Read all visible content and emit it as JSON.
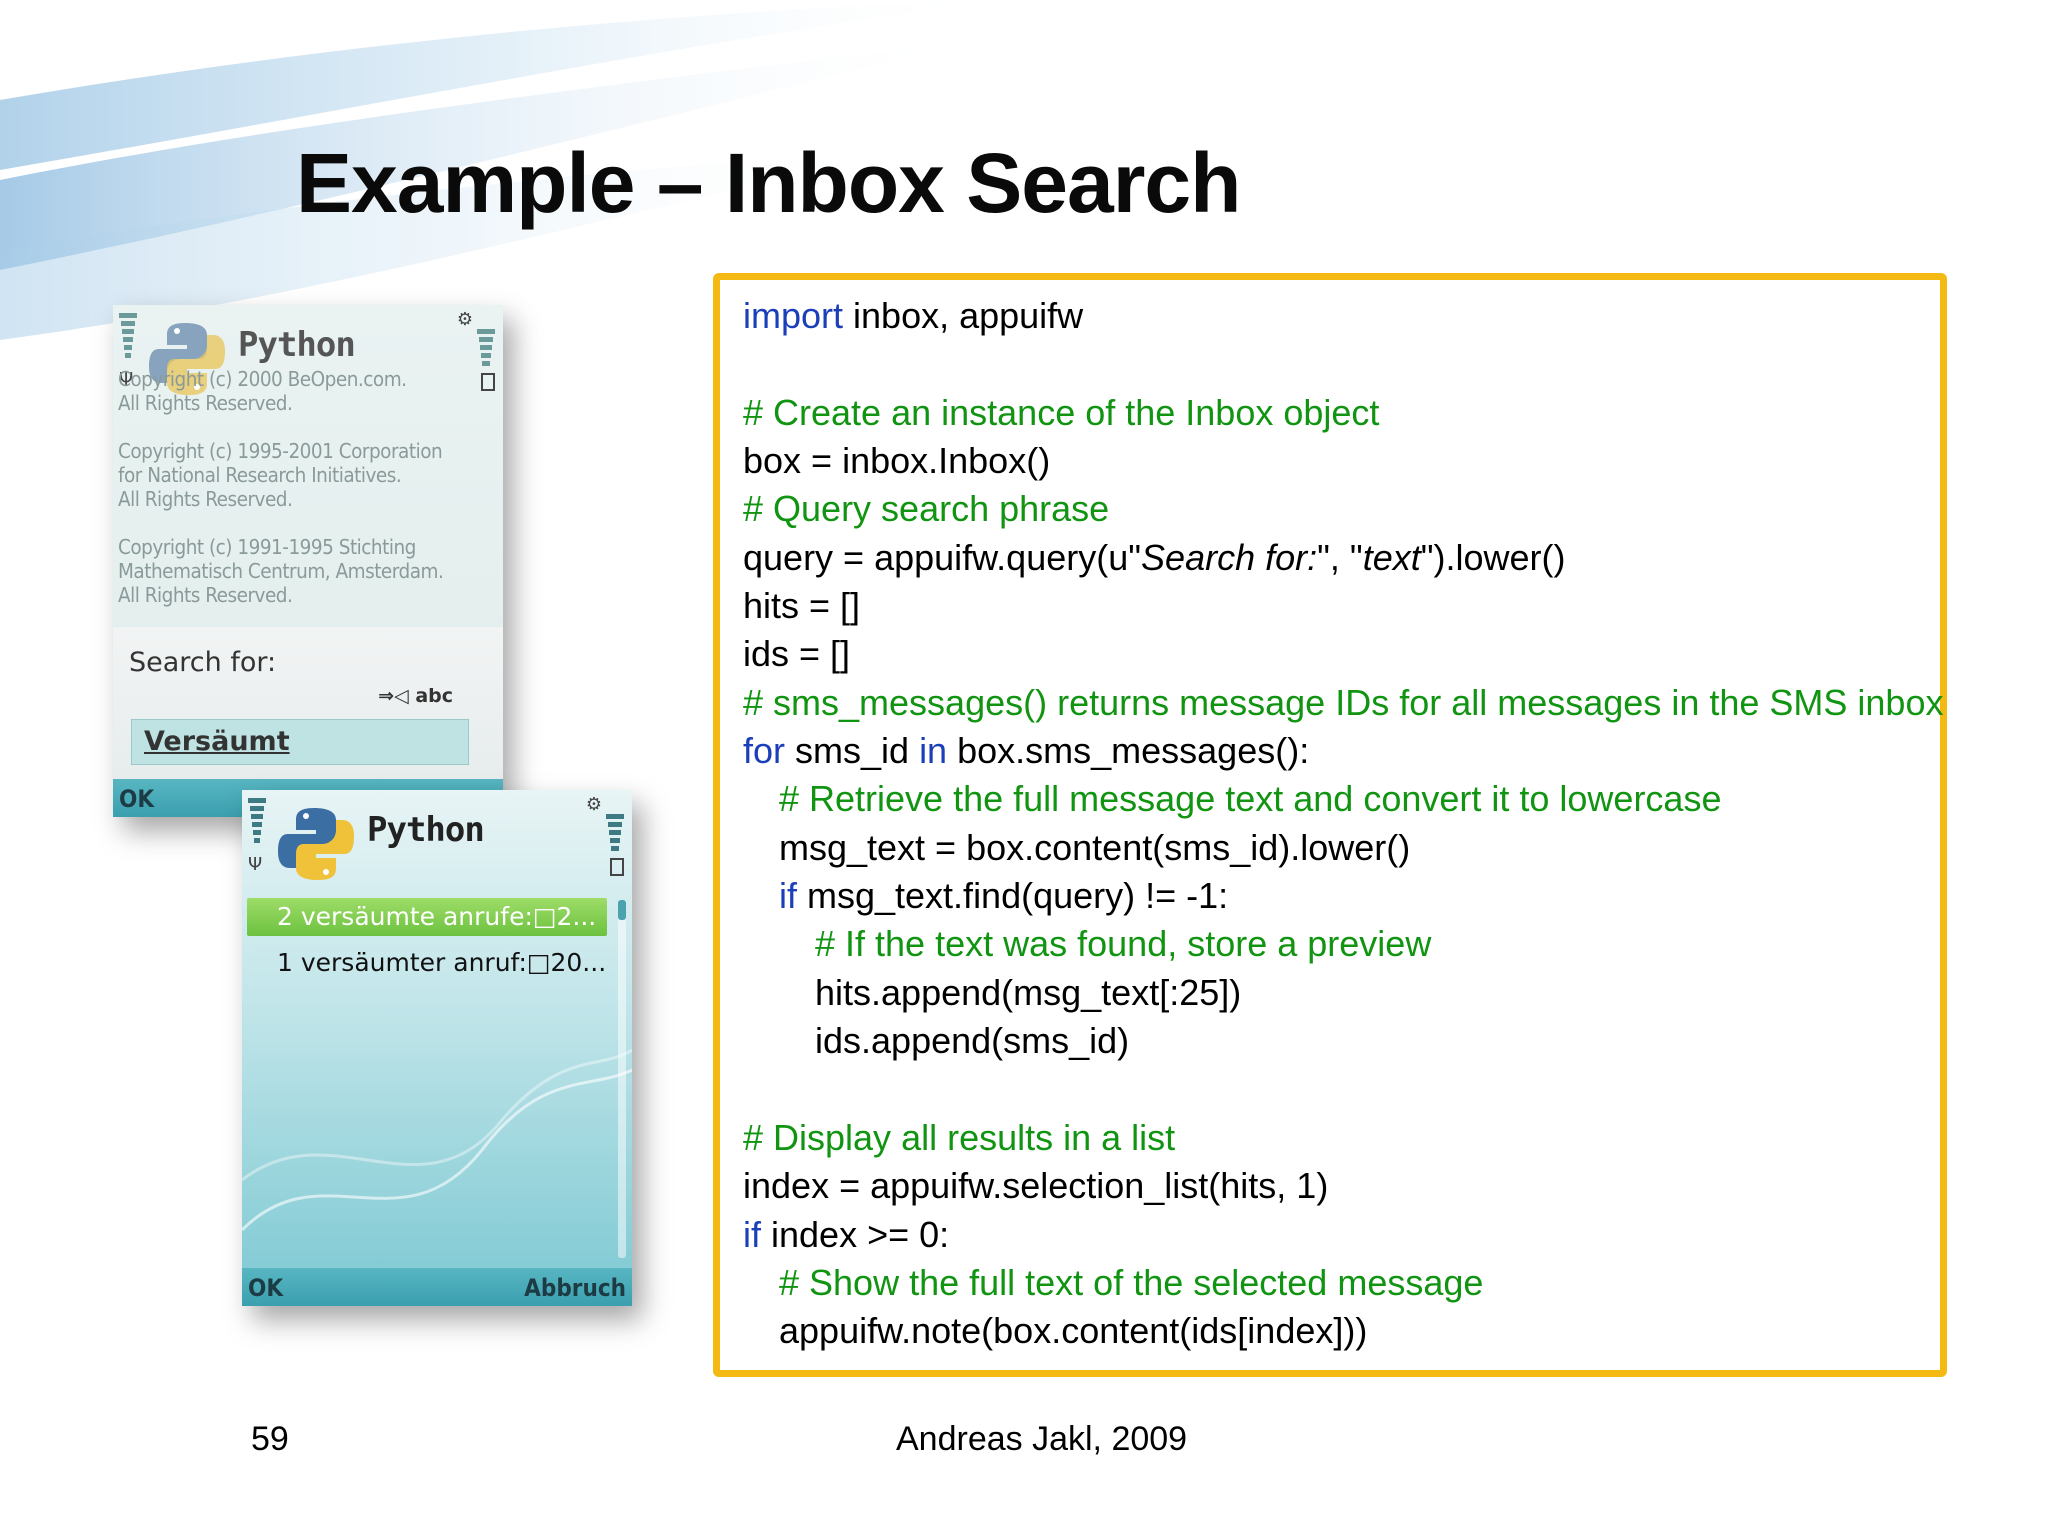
{
  "slide": {
    "title": "Example – Inbox Search",
    "page_number": "59",
    "footer": "Andreas Jakl, 2009"
  },
  "phone1": {
    "app_title": "Python",
    "credits": [
      "Copyright (c) 2000 BeOpen.com.\nAll Rights Reserved.",
      "Copyright (c) 1995-2001 Corporation\nfor National Research Initiatives.\nAll Rights Reserved.",
      "Copyright (c) 1991-1995 Stichting\nMathematisch Centrum, Amsterdam.\nAll Rights Reserved."
    ],
    "query_label": "Search for:",
    "input_mode": "abc",
    "query_value": "Versäumt",
    "softkey_left": "OK"
  },
  "phone2": {
    "app_title": "Python",
    "list_items": [
      {
        "text": "2 versäumte anrufe:□2...",
        "selected": true
      },
      {
        "text": "1 versäumter anruf:□20...",
        "selected": false
      }
    ],
    "softkey_left": "OK",
    "softkey_right": "Abbruch"
  },
  "code": {
    "l1_kw": "import",
    "l1_rest": " inbox, appuifw",
    "l3": "# Create an instance of the Inbox object",
    "l4": "box = inbox.Inbox()",
    "l5": "# Query search phrase",
    "l6_a": "query = appuifw.query(u\"",
    "l6_b": "Search for:",
    "l6_c": "\", \"",
    "l6_d": "text",
    "l6_e": "\").lower()",
    "l7": "hits = []",
    "l8": "ids = []",
    "l9": "# sms_messages() returns message IDs for all messages in the SMS inbox",
    "l10_kw1": "for",
    "l10_a": " sms_id ",
    "l10_kw2": "in",
    "l10_b": " box.sms_messages():",
    "l11": "# Retrieve the full message text and convert it to lowercase",
    "l12": "msg_text = box.content(sms_id).lower()",
    "l13_kw": "if",
    "l13_rest": " msg_text.find(query) != -1:",
    "l14": "# If the text was found, store a preview",
    "l15": "hits.append(msg_text[:25])",
    "l16": "ids.append(sms_id)",
    "l18": "# Display all results in a list",
    "l19": "index = appuifw.selection_list(hits, 1)",
    "l20_kw": "if",
    "l20_rest": " index >= 0:",
    "l21": "# Show the full text of the selected message",
    "l22": "appuifw.note(box.content(ids[index]))"
  },
  "colors": {
    "keyword": "#1a3fb8",
    "comment": "#119411",
    "code_border": "#f5b914"
  },
  "icons": [
    "python-logo-icon",
    "signal-bars-icon",
    "battery-bars-icon",
    "antenna-icon",
    "gear-icon",
    "battery-icon",
    "input-mode-icon"
  ]
}
